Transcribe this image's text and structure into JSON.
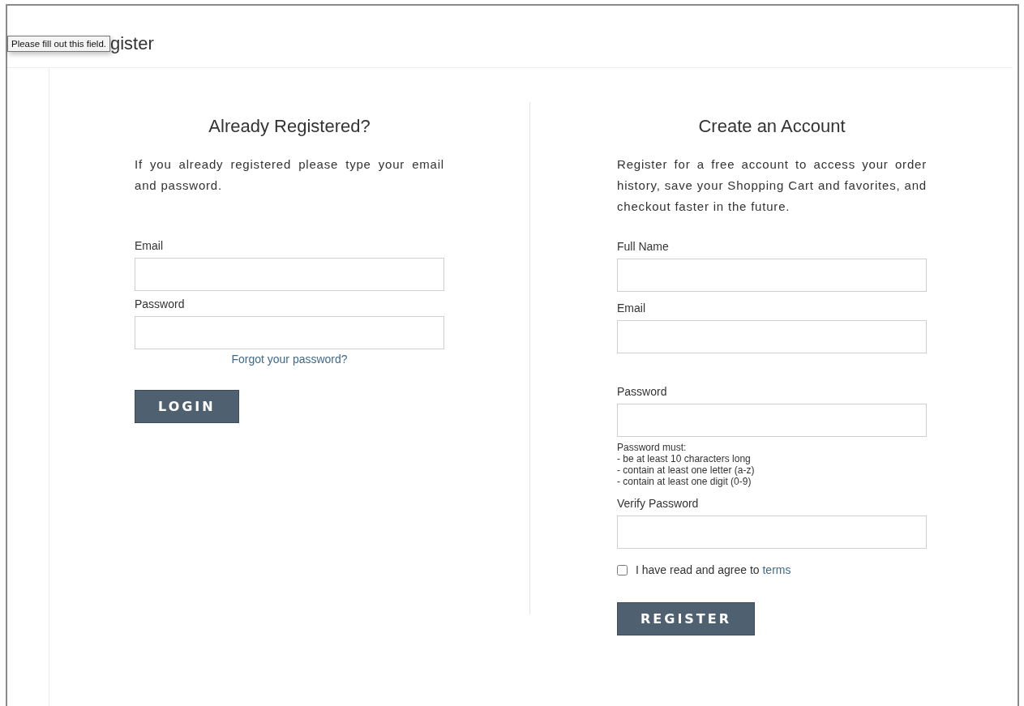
{
  "page_title": {
    "visible_text": "gister"
  },
  "tooltip": {
    "text": "Please fill out this field."
  },
  "login": {
    "heading": "Already Registered?",
    "intro": "If you already registered please type your email and password.",
    "fields": [
      {
        "label": "Email"
      },
      {
        "label": "Password"
      }
    ],
    "forgot_link": "Forgot your password?",
    "button": "LOGIN"
  },
  "register": {
    "heading": "Create an Account",
    "intro": "Register for a free account to access your order history, save your Shopping Cart and favorites, and checkout faster in the future.",
    "fields": [
      {
        "label": "Full Name",
        "kind": "plain"
      },
      {
        "label": "Email",
        "kind": "spaced"
      },
      {
        "label": "Password",
        "kind": "rules",
        "rules_title": "Password must:",
        "rules": [
          "- be at least 10 characters long",
          "- contain at least one letter (a-z)",
          "- contain at least one digit (0-9)"
        ]
      },
      {
        "label": "Verify Password",
        "kind": "plain"
      }
    ],
    "agree": {
      "text": "I have read and agree to ",
      "link": "terms",
      "checked": false
    },
    "button": "REGISTER"
  }
}
